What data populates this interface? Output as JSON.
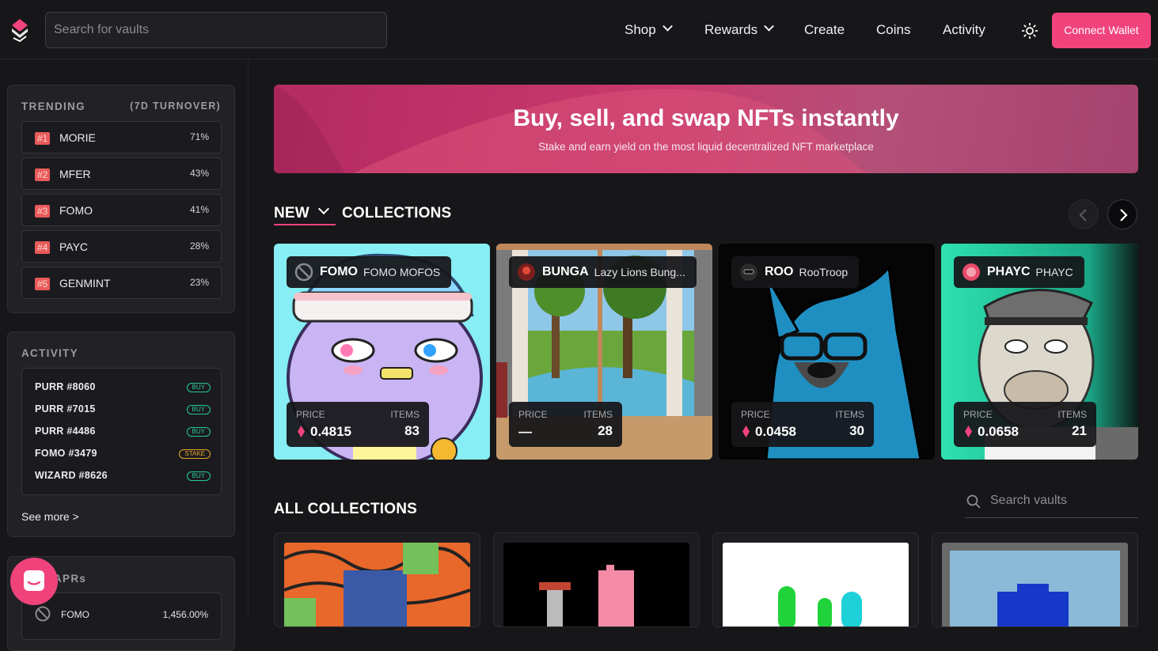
{
  "header": {
    "search_placeholder": "Search for vaults",
    "nav": {
      "shop": "Shop",
      "rewards": "Rewards",
      "create": "Create",
      "coins": "Coins",
      "activity": "Activity"
    },
    "connect_wallet": "Connect Wallet"
  },
  "sidebar": {
    "trending": {
      "title": "TRENDING",
      "subtitle": "(7D TURNOVER)",
      "items": [
        {
          "rank": "#1",
          "name": "MORIE",
          "pct": "71%"
        },
        {
          "rank": "#2",
          "name": "MFER",
          "pct": "43%"
        },
        {
          "rank": "#3",
          "name": "FOMO",
          "pct": "41%"
        },
        {
          "rank": "#4",
          "name": "PAYC",
          "pct": "28%"
        },
        {
          "rank": "#5",
          "name": "GENMINT",
          "pct": "23%"
        }
      ]
    },
    "activity": {
      "title": "ACTIVITY",
      "items": [
        {
          "name": "PURR #8060",
          "tag": "BUY"
        },
        {
          "name": "PURR #7015",
          "tag": "BUY"
        },
        {
          "name": "PURR #4486",
          "tag": "BUY"
        },
        {
          "name": "FOMO #3479",
          "tag": "STAKE"
        },
        {
          "name": "WIZARD #8626",
          "tag": "BUY"
        }
      ],
      "see_more": "See more >"
    },
    "aprs": {
      "title": "APRs",
      "first_item": {
        "name": "FOMO",
        "value": "1,456.00%"
      }
    }
  },
  "banner": {
    "title": "Buy, sell, and swap NFTs instantly",
    "subtitle": "Stake and earn yield on the most liquid decentralized NFT marketplace"
  },
  "new_collections": {
    "filter_label": "NEW",
    "title": "COLLECTIONS",
    "cards": [
      {
        "symbol": "FOMO",
        "name": "FOMO MOFOS",
        "price_label": "PRICE",
        "items_label": "ITEMS",
        "price": "0.4815",
        "items": "83"
      },
      {
        "symbol": "BUNGA",
        "name": "Lazy Lions Bung...",
        "price_label": "PRICE",
        "items_label": "ITEMS",
        "price": "—",
        "items": "28"
      },
      {
        "symbol": "ROO",
        "name": "RooTroop",
        "price_label": "PRICE",
        "items_label": "ITEMS",
        "price": "0.0458",
        "items": "30"
      },
      {
        "symbol": "PHAYC",
        "name": "PHAYC",
        "price_label": "PRICE",
        "items_label": "ITEMS",
        "price": "0.0658",
        "items": "21"
      }
    ]
  },
  "all_collections": {
    "title": "ALL COLLECTIONS",
    "search_placeholder": "Search vaults"
  },
  "colors": {
    "accent": "#f0437c",
    "background": "#17171a",
    "panel": "#222226",
    "buy": "#27c79a",
    "stake": "#e6a72a"
  }
}
